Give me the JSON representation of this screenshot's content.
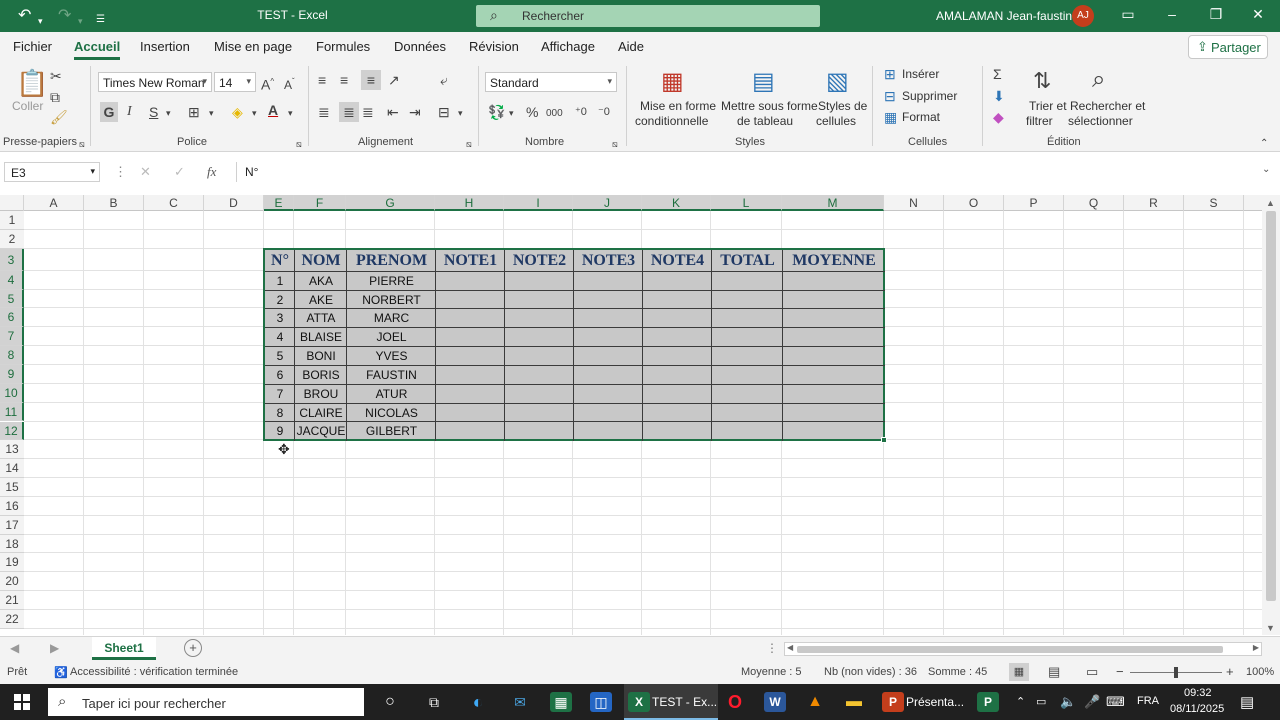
{
  "titlebar": {
    "title": "TEST  -  Excel",
    "search_placeholder": "Rechercher",
    "user_name": "AMALAMAN Jean-faustin",
    "user_initials": "AJ"
  },
  "menu": {
    "tabs": [
      "Fichier",
      "Accueil",
      "Insertion",
      "Mise en page",
      "Formules",
      "Données",
      "Révision",
      "Affichage",
      "Aide"
    ],
    "active_tab": "Accueil",
    "share_label": "Partager"
  },
  "ribbon": {
    "groups": {
      "presse_papiers": "Presse-papiers",
      "police": "Police",
      "alignement": "Alignement",
      "nombre": "Nombre",
      "styles": "Styles",
      "cellules": "Cellules",
      "edition": "Édition"
    },
    "coller_label": "Coller",
    "font_name": "Times New Roman",
    "font_size": "14",
    "number_format": "Standard",
    "mise_en_forme_1": "Mise en forme",
    "mise_en_forme_2": "conditionnelle",
    "mettre_tableau_1": "Mettre sous forme",
    "mettre_tableau_2": "de tableau",
    "styles_cellules_1": "Styles de",
    "styles_cellules_2": "cellules",
    "inserer": "Insérer",
    "supprimer": "Supprimer",
    "format": "Format",
    "trier_1": "Trier et",
    "trier_2": "filtrer",
    "rechercher_1": "Rechercher et",
    "rechercher_2": "sélectionner",
    "bold": "G",
    "italic": "I",
    "underline": "S"
  },
  "formula_bar": {
    "cell_ref": "E3",
    "formula": "N°"
  },
  "sheet": {
    "columns": [
      "A",
      "B",
      "C",
      "D",
      "E",
      "F",
      "G",
      "H",
      "I",
      "J",
      "K",
      "L",
      "M",
      "N",
      "O",
      "P",
      "Q",
      "R",
      "S"
    ],
    "rows": [
      "1",
      "2",
      "3",
      "4",
      "5",
      "6",
      "7",
      "8",
      "9",
      "10",
      "11",
      "12",
      "13",
      "14",
      "15",
      "16",
      "17",
      "18",
      "19",
      "20",
      "21",
      "22"
    ],
    "table_headers": [
      "N°",
      "NOM",
      "PRENOM",
      "NOTE1",
      "NOTE2",
      "NOTE3",
      "NOTE4",
      "TOTAL",
      "MOYENNE"
    ],
    "table_rows": [
      [
        "1",
        "AKA",
        "PIERRE"
      ],
      [
        "2",
        "AKE",
        "NORBERT"
      ],
      [
        "3",
        "ATTA",
        "MARC"
      ],
      [
        "4",
        "BLAISE",
        "JOEL"
      ],
      [
        "5",
        "BONI",
        "YVES"
      ],
      [
        "6",
        "BORIS",
        "FAUSTIN"
      ],
      [
        "7",
        "BROU",
        "ATUR"
      ],
      [
        "8",
        "CLAIRE",
        "NICOLAS"
      ],
      [
        "9",
        "JACQUE",
        "GILBERT"
      ]
    ],
    "sheet_tab": "Sheet1"
  },
  "status": {
    "ready": "Prêt",
    "accessibility": "Accessibilité : vérification terminée",
    "average": "Moyenne : 5",
    "count": "Nb (non vides) : 36",
    "sum": "Somme : 45",
    "zoom": "100%"
  },
  "taskbar": {
    "search_placeholder": "Taper ici pour rechercher",
    "excel_item": "TEST - Ex...",
    "ppt_item": "Présenta...",
    "lang": "FRA",
    "time": "09:32",
    "date": "08/11/2025"
  },
  "colors": {
    "excel_green": "#1e7145",
    "selection_gray": "#c8c8c8",
    "header_text": "#1f3864"
  }
}
